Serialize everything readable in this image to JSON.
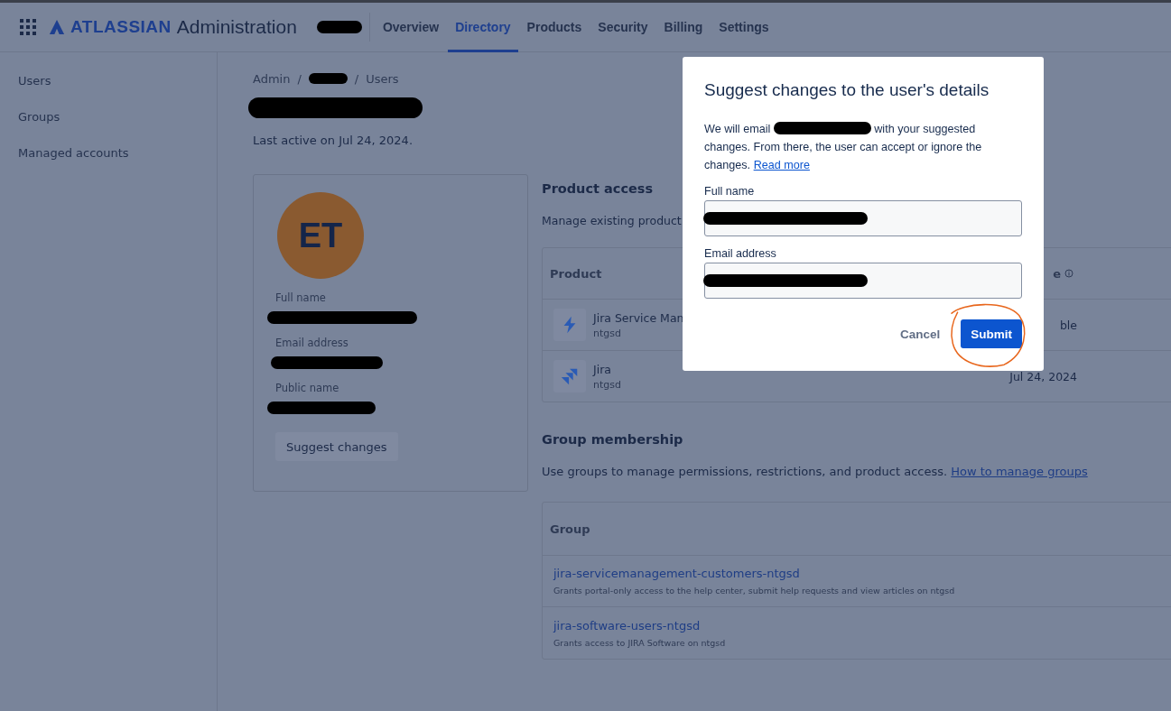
{
  "top_nav": {
    "brand": "ATLASSIAN",
    "product": "Administration",
    "org_redacted": true,
    "tabs": [
      {
        "label": "Overview",
        "selected": false
      },
      {
        "label": "Directory",
        "selected": true
      },
      {
        "label": "Products",
        "selected": false
      },
      {
        "label": "Security",
        "selected": false
      },
      {
        "label": "Billing",
        "selected": false
      },
      {
        "label": "Settings",
        "selected": false
      }
    ]
  },
  "sidebar": {
    "items": [
      {
        "label": "Users"
      },
      {
        "label": "Groups"
      },
      {
        "label": "Managed accounts"
      }
    ]
  },
  "breadcrumb": {
    "separator": "/",
    "items": [
      {
        "label": "Admin",
        "redacted": false
      },
      {
        "redacted": true
      },
      {
        "label": "Users",
        "redacted": false
      }
    ]
  },
  "user_title_redacted": true,
  "last_active": "Last active on Jul 24, 2024.",
  "profile": {
    "initials": "ET",
    "fields": [
      {
        "label": "Full name",
        "redacted": true
      },
      {
        "label": "Email address",
        "redacted": true
      },
      {
        "label": "Public name",
        "redacted": true
      }
    ],
    "button": "Suggest changes"
  },
  "product_access": {
    "title": "Product access",
    "description": "Manage existing product",
    "columns": [
      "Product",
      "e"
    ],
    "rows": [
      {
        "name": "Jira Service Man",
        "site": "ntgsd",
        "column_2": "ble"
      },
      {
        "name": "Jira",
        "site": "ntgsd",
        "column_2": "Jul 24, 2024"
      }
    ]
  },
  "group_membership": {
    "title": "Group membership",
    "description": "Use groups to manage permissions, restrictions, and product access.",
    "link": "How to manage groups",
    "columns": [
      "Group"
    ],
    "rows": [
      {
        "name": "jira-servicemanagement-customers-ntgsd",
        "description": "Grants portal-only access to the help center, submit help requests and view articles on ntgsd"
      },
      {
        "name": "jira-software-users-ntgsd",
        "description": "Grants access to JIRA Software on ntgsd"
      }
    ]
  },
  "dialog": {
    "title": "Suggest changes to the user's details",
    "body_before": "We will email",
    "email_redacted": true,
    "body_after": "with your suggested changes. From there, the user can accept or ignore the changes.",
    "link": "Read more",
    "fields": [
      {
        "label": "Full name",
        "redacted": true
      },
      {
        "label": "Email address",
        "redacted": true
      }
    ],
    "buttons": [
      {
        "label": "Cancel",
        "kind": "subtle",
        "circled": false
      },
      {
        "label": "Submit",
        "kind": "primary",
        "circled": true
      }
    ]
  }
}
